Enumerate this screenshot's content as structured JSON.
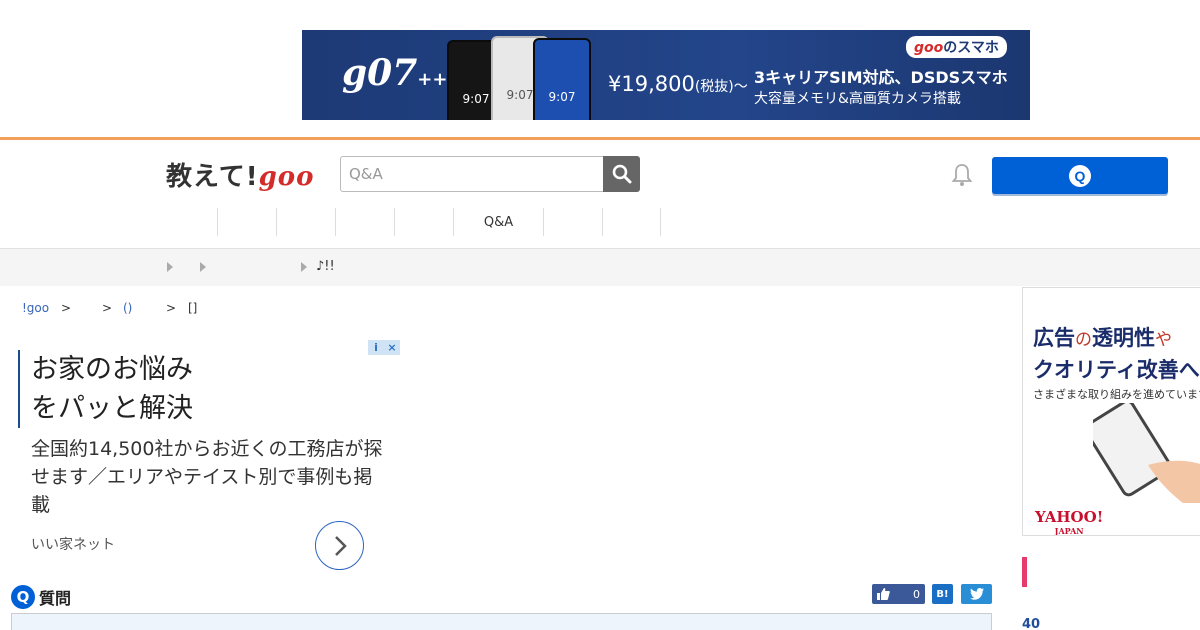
{
  "banner": {
    "brand": "g07",
    "brand_suffix": "++",
    "phone_time": "9:07",
    "price": "¥19,800",
    "price_note": "(税抜)〜",
    "headline": "3キャリアSIM対応、DSDSスマホ",
    "subline": "大容量メモリ&高画質カメラ搭載",
    "badge_goo": "goo",
    "badge_text": "のスマホ"
  },
  "header": {
    "logo_text": "教えて!",
    "logo_goo": "goo",
    "search_placeholder": "Q&A",
    "ask_icon": "Q"
  },
  "nav": {
    "items": [
      "",
      "",
      "",
      "",
      "Q&A",
      "",
      "",
      ""
    ]
  },
  "subnav": {
    "text": "♪!!"
  },
  "breadcrumb": {
    "home": "!goo",
    "sep": ">",
    "category": "()",
    "last": "[]"
  },
  "left_ad": {
    "info_icon": "i",
    "close_icon": "×",
    "title_line1": "お家のお悩み",
    "title_line2": "をパッと解決",
    "body": "全国約14,500社からお近くの工務店が探せます／エリアやテイスト別で事例も掲載",
    "source": "いい家ネット"
  },
  "question": {
    "badge": "Q",
    "label": "質問",
    "like_count": "0",
    "hatena_label": "B!"
  },
  "right_ad": {
    "line1_a": "広告",
    "line1_b": "の",
    "line1_c": "透明性",
    "line1_d": "や",
    "line2": "クオリティ改善へ",
    "line3": "さまざまな取り組みを進めています",
    "logo": "YAHOO!",
    "logo_sub": "JAPAN"
  },
  "sidebar": {
    "count": "40"
  },
  "colors": {
    "accent_orange": "#f0a05a",
    "primary_blue": "#0060d6",
    "goo_red": "#d42b2b",
    "pink_accent": "#e73c6b"
  }
}
